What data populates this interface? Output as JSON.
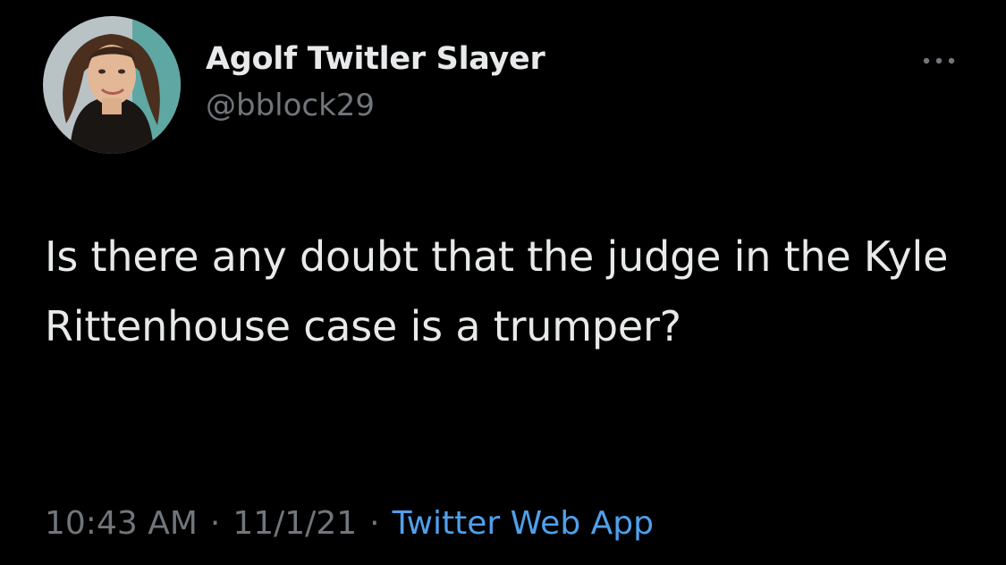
{
  "tweet": {
    "author": {
      "display_name": "Agolf Twitler Slayer",
      "handle": "@bblock29",
      "avatar_icon": "profile-photo"
    },
    "more_icon": "more-horizontal-icon",
    "text": "Is there any doubt that the judge in the Kyle Rittenhouse case is a trumper?",
    "time": "10:43 AM",
    "separator": "·",
    "date": "11/1/21",
    "source": "Twitter Web App"
  },
  "colors": {
    "background": "#000000",
    "primary_text": "#e7e9ea",
    "secondary_text": "#71767b",
    "link": "#4fa0ec"
  }
}
